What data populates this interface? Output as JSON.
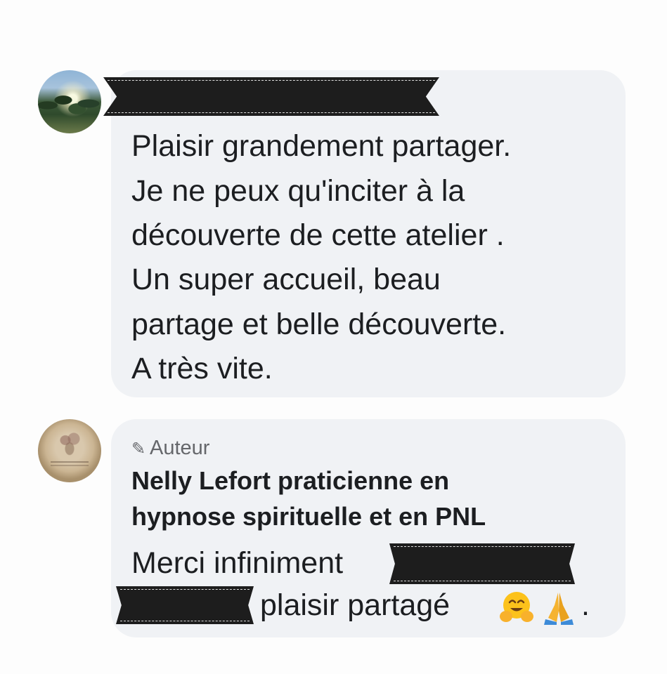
{
  "comment": {
    "lines": [
      "Plaisir grandement partager.",
      "Je ne peux qu'inciter à la",
      "découverte de cette atelier .",
      "Un super accueil, beau",
      "partage et belle découverte.",
      "A très vite."
    ]
  },
  "reply": {
    "badge_label": "Auteur",
    "badge_icon": "pencil-icon",
    "author_lines": [
      "Nelly Lefort praticienne en",
      "hypnose spirituelle et en PNL"
    ],
    "text_start": "Merci infiniment",
    "text_end": "plaisir partagé",
    "emojis": [
      "hugging-face-icon",
      "folded-hands-icon"
    ],
    "trailing": "."
  },
  "colors": {
    "bubble": "#f0f2f5",
    "text": "#1c1e21",
    "muted": "#65676b",
    "redaction": "#1d1d1d"
  }
}
